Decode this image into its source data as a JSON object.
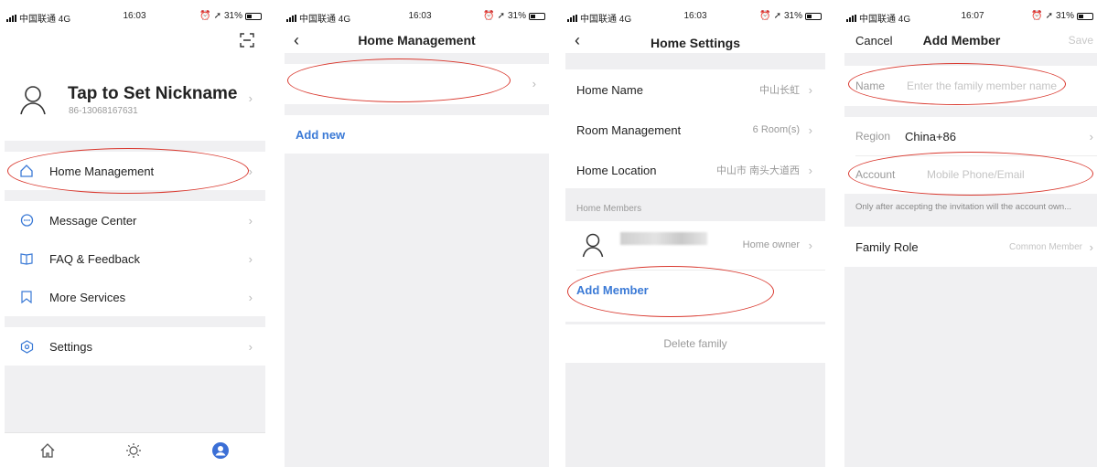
{
  "status": {
    "carrier": "中国联通 4G",
    "battery": "31%",
    "time_1": "16:03",
    "time_2": "16:03",
    "time_3": "16:03",
    "time_4": "16:07"
  },
  "screen1": {
    "nickname": "Tap to Set Nickname",
    "phone": "86-13068167631",
    "menu": {
      "home_management": "Home Management",
      "message_center": "Message Center",
      "faq": "FAQ & Feedback",
      "more_services": "More Services",
      "settings": "Settings"
    },
    "tabs": [
      {
        "label": "Home",
        "icon": "home-icon"
      },
      {
        "label": "Smart",
        "icon": "sun-icon"
      },
      {
        "label": "Me",
        "icon": "profile-icon"
      }
    ]
  },
  "screen2": {
    "title": "Home Management",
    "add_new": "Add new"
  },
  "screen3": {
    "title": "Home Settings",
    "home_name_label": "Home Name",
    "home_name_value": "中山长虹",
    "room_management_label": "Room Management",
    "room_management_value": "6 Room(s)",
    "home_location_label": "Home Location",
    "home_location_value": "中山市 南头大道西",
    "members_header": "Home Members",
    "member_role": "Home owner",
    "add_member": "Add Member",
    "delete_family": "Delete family"
  },
  "screen4": {
    "cancel": "Cancel",
    "title": "Add Member",
    "save": "Save",
    "name_label": "Name",
    "name_placeholder": "Enter the family member name",
    "region_label": "Region",
    "region_value": "China+86",
    "account_label": "Account",
    "account_placeholder": "Mobile Phone/Email",
    "account_hint": "Only after accepting the invitation will the account own...",
    "role_label": "Family Role",
    "role_value": "Common Member"
  },
  "colors": {
    "accent": "#3b7ad6",
    "annotation": "#d9382e",
    "avatar_active": "#3b6fd6"
  }
}
